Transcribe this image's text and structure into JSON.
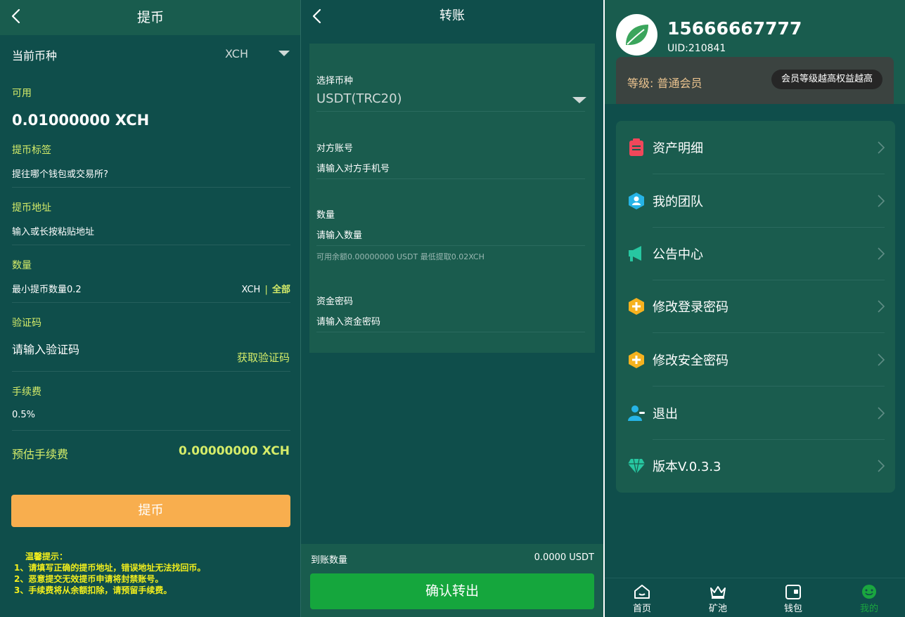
{
  "withdraw": {
    "title": "提币",
    "currency_label": "当前币种",
    "currency_value": "XCH",
    "available_label": "可用",
    "available_value": "0.01000000 XCH",
    "tag_label": "提币标签",
    "tag_placeholder": "提往哪个钱包或交易所?",
    "address_label": "提币地址",
    "address_placeholder": "输入或长按粘贴地址",
    "amount_label": "数量",
    "amount_placeholder": "最小提币数量0.2",
    "amount_unit": "XCH",
    "amount_sep": "|",
    "amount_all": "全部",
    "code_label": "验证码",
    "code_placeholder": "请输入验证码",
    "get_code": "获取验证码",
    "fee_label": "手续费",
    "fee_value": "0.5%",
    "est_fee_label": "预估手续费",
    "est_fee_value": "0.00000000 XCH",
    "submit": "提币",
    "tips_title": "温馨提示：",
    "tips": [
      "1、请填写正确的提币地址，错误地址无法找回币。",
      "2、恶意提交无效提币申请将封禁账号。",
      "3、手续费将从余额扣除，请预留手续费。"
    ]
  },
  "transfer": {
    "title": "转账",
    "coin_label": "选择币种",
    "coin_value": "USDT(TRC20)",
    "account_label": "对方账号",
    "account_placeholder": "请输入对方手机号",
    "amount_label": "数量",
    "amount_placeholder": "请输入数量",
    "balance_hint": "可用余额0.00000000 USDT 最低提取0.02XCH",
    "password_label": "资金密码",
    "password_placeholder": "请输入资金密码",
    "arrival_label": "到账数量",
    "arrival_value": "0.0000 USDT",
    "confirm": "确认转出"
  },
  "profile": {
    "phone": "15666667777",
    "uid": "UID:210841",
    "level": "等级: 普通会员",
    "level_badge": "会员等级越高权益越高",
    "menu": [
      {
        "label": "资产明细",
        "icon": "clipboard-icon",
        "color": "#f0475a"
      },
      {
        "label": "我的团队",
        "icon": "team-icon",
        "color": "#26b4e6"
      },
      {
        "label": "公告中心",
        "icon": "megaphone-icon",
        "color": "#27c7a1"
      },
      {
        "label": "修改登录密码",
        "icon": "plus-hexagon-icon",
        "color": "#f6b21f"
      },
      {
        "label": "修改安全密码",
        "icon": "plus-hexagon-icon",
        "color": "#f6b21f"
      },
      {
        "label": "退出",
        "icon": "user-logout-icon",
        "color": "#26b4e6"
      },
      {
        "label": "版本V.0.3.3",
        "icon": "diamond-icon",
        "color": "#27c7a1"
      }
    ],
    "tabs": [
      {
        "label": "首页",
        "icon": "home-icon"
      },
      {
        "label": "矿池",
        "icon": "crown-icon"
      },
      {
        "label": "钱包",
        "icon": "wallet-icon"
      },
      {
        "label": "我的",
        "icon": "smile-icon",
        "active": true
      }
    ],
    "tab_active_color": "#1aa63f"
  }
}
